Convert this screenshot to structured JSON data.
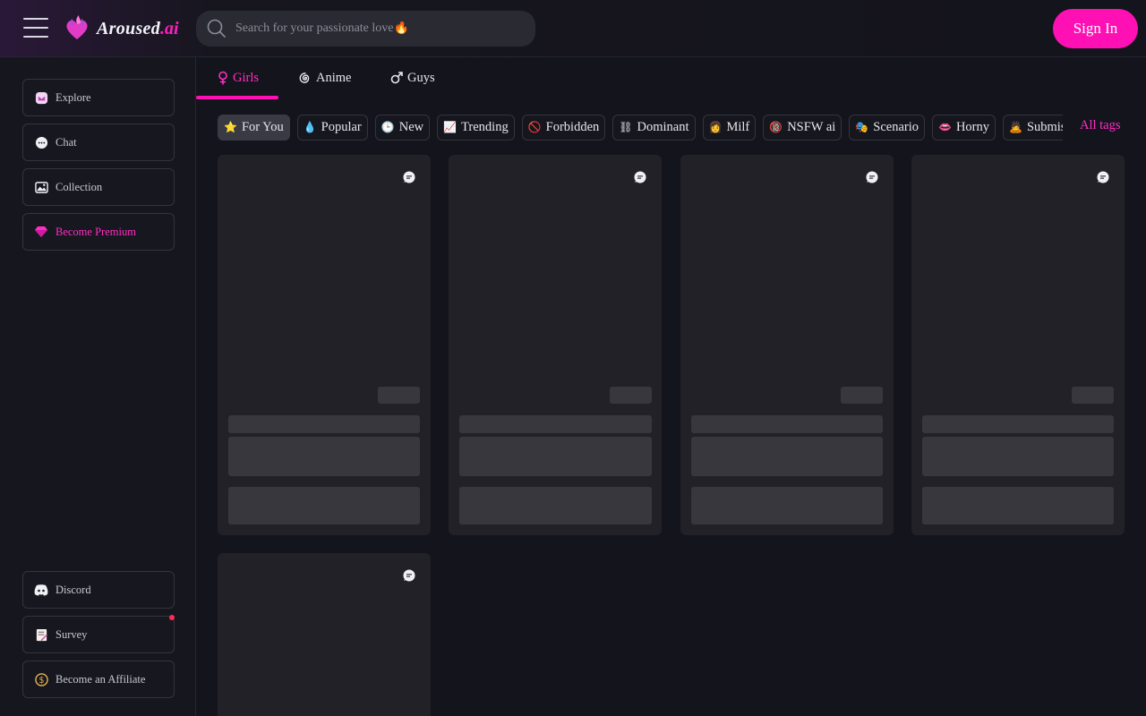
{
  "header": {
    "logo_text": "Aroused",
    "logo_suffix": ".ai",
    "search_placeholder": "Search for your passionate love🔥",
    "signin_label": "Sign In"
  },
  "sidebar": {
    "top_items": [
      {
        "label": "Explore",
        "icon": "explore-icon"
      },
      {
        "label": "Chat",
        "icon": "chat-icon"
      },
      {
        "label": "Collection",
        "icon": "gallery-icon"
      },
      {
        "label": "Become Premium",
        "icon": "diamond-icon"
      }
    ],
    "bottom_items": [
      {
        "label": "Discord",
        "icon": "discord-icon"
      },
      {
        "label": "Survey",
        "icon": "survey-icon"
      },
      {
        "label": "Become an Affiliate",
        "icon": "coin-icon"
      }
    ]
  },
  "categories": [
    {
      "label": "Girls",
      "icon": "female-icon",
      "active": true
    },
    {
      "label": "Anime",
      "icon": "spiral-icon"
    },
    {
      "label": "Guys",
      "icon": "male-icon"
    }
  ],
  "tags": [
    {
      "emoji": "⭐",
      "label": "For You",
      "active": true
    },
    {
      "emoji": "💧",
      "label": "Popular"
    },
    {
      "emoji": "🕒",
      "label": "New"
    },
    {
      "emoji": "📈",
      "label": "Trending"
    },
    {
      "emoji": "🚫",
      "label": "Forbidden"
    },
    {
      "emoji": "⛓",
      "label": "Dominant"
    },
    {
      "emoji": "👩",
      "label": "Milf"
    },
    {
      "emoji": "🔞",
      "label": "NSFW ai"
    },
    {
      "emoji": "🎭",
      "label": "Scenario"
    },
    {
      "emoji": "👄",
      "label": "Horny"
    },
    {
      "emoji": "🙇",
      "label": "Submissi"
    }
  ],
  "all_tags_label": "All tags",
  "colors": {
    "accent": "#ff10b4",
    "background": "#14141c",
    "card": "#212127",
    "skeleton": "#37373d"
  }
}
